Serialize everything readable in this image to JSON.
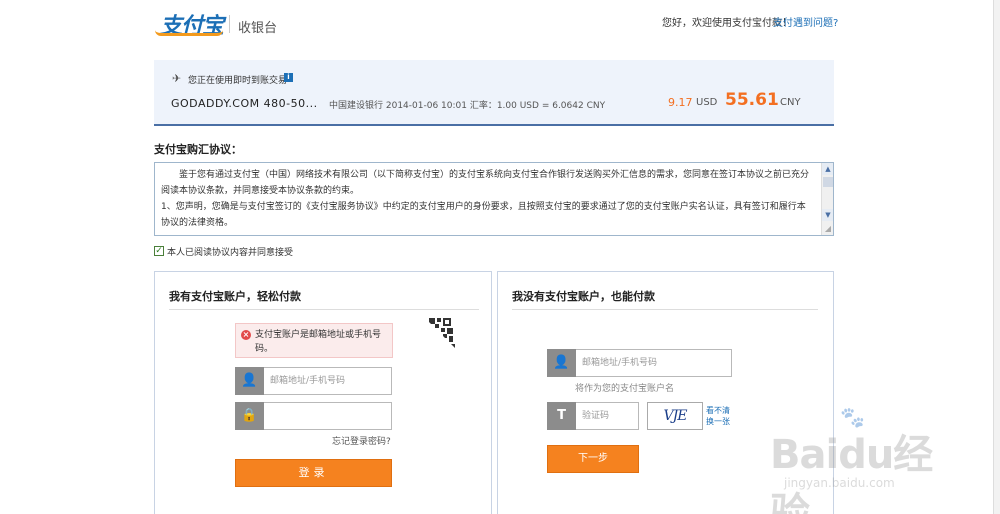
{
  "header": {
    "logo_text": "支付宝",
    "subtitle": "收银台",
    "greeting": "您好，欢迎使用支付宝付款！",
    "help_link": "支付遇到问题?"
  },
  "transaction": {
    "notice": "您正在使用即时到账交易",
    "info_icon": "i",
    "merchant": "GODADDY.COM 480-50...",
    "detail": "中国建设银行 2014-01-06 10:01 汇率：1.00 USD = 6.0642 CNY",
    "usd_amount": "9.17",
    "usd_currency": "USD",
    "cny_amount": "55.61",
    "cny_currency": "CNY"
  },
  "agreement": {
    "title": "支付宝购汇协议：",
    "paragraphs": [
      "鉴于您有通过支付宝（中国）网络技术有限公司（以下简称支付宝）的支付宝系统向支付宝合作银行发送购买外汇信息的需求，您同意在签订本协议之前已充分阅读本协议条款，并同意接受本协议条款的约束。",
      "1、您声明，您确是与支付宝签订的《支付宝服务协议》中约定的支付宝用户的身份要求，且按照支付宝的要求通过了您的支付宝账户实名认证，具有签订和履行本协议的法律资格。"
    ],
    "checkbox_label": "本人已阅读协议内容并同意接受",
    "checked": true
  },
  "left_panel": {
    "title": "我有支付宝账户，轻松付款",
    "error_message": "支付宝账户是邮箱地址或手机号码。",
    "email_placeholder": "邮箱地址/手机号码",
    "password_value": "",
    "forgot_password": "忘记登录密码?",
    "login_button": "登录"
  },
  "right_panel": {
    "title": "我没有支付宝账户，也能付款",
    "email_placeholder": "邮箱地址/手机号码",
    "email_hint": "将作为您的支付宝账户名",
    "captcha_placeholder": "验证码",
    "captcha_text": "VJE",
    "captcha_refresh": "看不清 换一张",
    "next_button": "下一步"
  },
  "watermark": {
    "brand": "Baidu经验",
    "url": "jingyan.baidu.com"
  },
  "colors": {
    "brand_blue": "#1c6fb6",
    "accent_orange": "#f5821f",
    "amount_orange": "#f36f21"
  }
}
